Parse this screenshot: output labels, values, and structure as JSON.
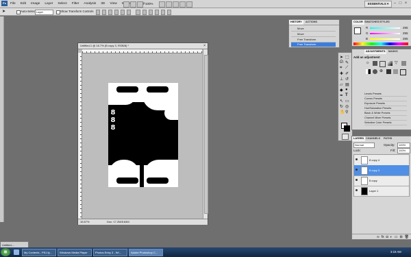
{
  "app": {
    "logo": "Ps",
    "menus": [
      "File",
      "Edit",
      "Image",
      "Layer",
      "Select",
      "Filter",
      "Analysis",
      "3D",
      "View",
      "Window",
      "Help"
    ],
    "zoom": "100%",
    "workspace": "ESSENTIALS",
    "workspace_arrow": "▾",
    "window_controls": [
      "–",
      "□",
      "×"
    ]
  },
  "options": {
    "auto_select_label": "Auto-Select:",
    "auto_select_value": "Layer",
    "transform_label": "Show Transform Controls"
  },
  "document": {
    "title": "Untitled-1 @ 16.7% (B copy 3, RGB/8) *",
    "zoom": "16.67%",
    "doc_size": "Doc: 17.2M/8.84M",
    "digits": [
      "8",
      "8",
      "8"
    ],
    "minimized_title": "Untitled-..."
  },
  "history": {
    "tabs": [
      "HISTORY",
      "ACTIONS"
    ],
    "items": [
      "Move",
      "Move",
      "Free Transform",
      "Free Transform"
    ],
    "selected_index": 3
  },
  "color": {
    "tabs": [
      "COLOR",
      "SWATCHES",
      "STYLES"
    ],
    "channels": [
      {
        "label": "R",
        "value": "255",
        "color": "#e03030"
      },
      {
        "label": "G",
        "value": "255",
        "color": "#30c030"
      },
      {
        "label": "B",
        "value": "255",
        "color": "#3050e0"
      }
    ]
  },
  "adjustments": {
    "tabs": [
      "ADJUSTMENTS",
      "MASKS"
    ],
    "heading": "Add an adjustment",
    "presets": [
      "Levels Presets",
      "Curves Presets",
      "Exposure Presets",
      "Hue/Saturation Presets",
      "Black & White Presets",
      "Channel Mixer Presets",
      "Selective Color Presets"
    ]
  },
  "layers": {
    "tabs": [
      "LAYERS",
      "CHANNELS",
      "PATHS"
    ],
    "blend_mode": "Normal",
    "opacity_label": "Opacity:",
    "opacity": "100%",
    "lock_label": "Lock:",
    "fill_label": "Fill:",
    "fill": "100%",
    "items": [
      {
        "name": "8 copy 4",
        "selected": false,
        "fill": "white"
      },
      {
        "name": "8 copy 3",
        "selected": true,
        "fill": "white"
      },
      {
        "name": "8 copy",
        "selected": false,
        "fill": "white"
      },
      {
        "name": "Layer 1",
        "selected": false,
        "fill": "black"
      }
    ]
  },
  "taskbar": {
    "start": "⊞",
    "tasks": [
      "My Contents - PSJ.fy...",
      "Windows Media Player",
      "Photos Entry 3 - Wi...",
      "Adobe Photoshop C..."
    ],
    "active_index": 3,
    "clock": "3:19 AM"
  },
  "colors": {
    "selection": "#3b7ddd",
    "canvas_black": "#000000",
    "canvas_white": "#ffffff",
    "workspace_bg": "#6f6f6f"
  }
}
